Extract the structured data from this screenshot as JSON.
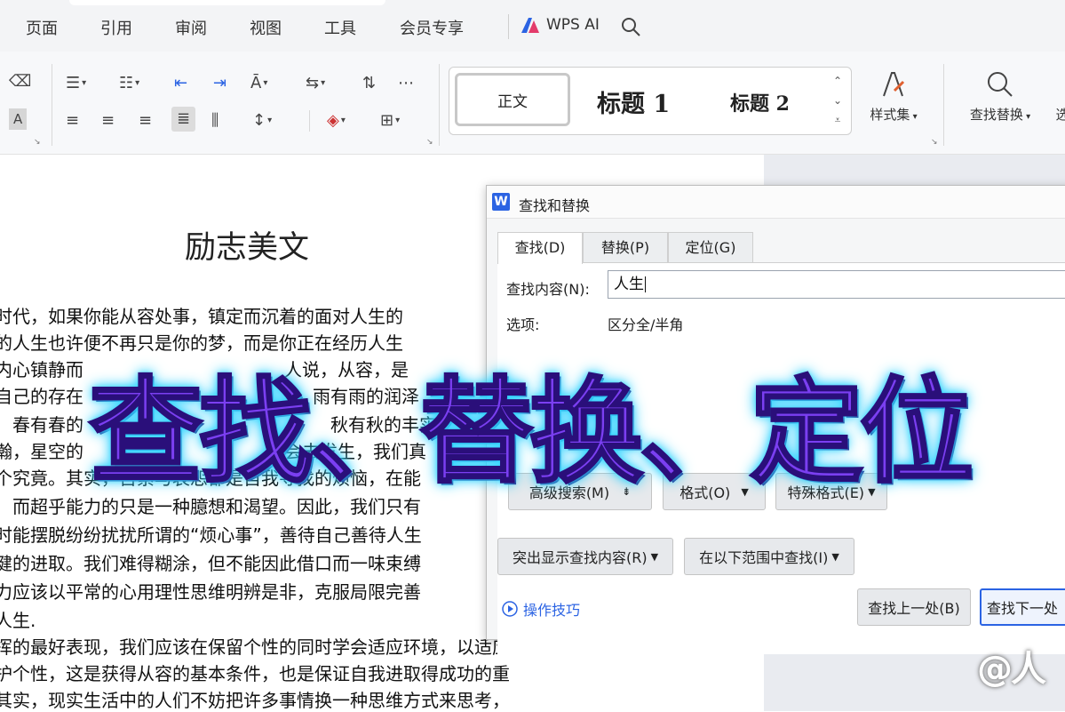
{
  "menu": {
    "items": [
      "页面",
      "引用",
      "审阅",
      "视图",
      "工具",
      "会员专享"
    ],
    "ai_label": "WPS AI"
  },
  "ribbon": {
    "styles": {
      "normal": "正文",
      "heading1": "标题 1",
      "heading2": "标题 2"
    },
    "style_set_label": "样式集",
    "find_replace_label": "查找替换",
    "truncated_label": "选"
  },
  "document": {
    "title": "励志美文",
    "lines": [
      "时代，如果你能从容处事，镇定而沉着的面对人生的",
      "的人生也许便不再只是你的梦，而是你正在经历人生",
      "内心镇静而",
      "自己的存在",
      "春有春的",
      "瀚，星空的",
      "个究竟。其实，苦累与哀怨都是自我寻找的烦恼，在能",
      "而超乎能力的只是一种臆想和渴望。因此，我们只有",
      "时能摆脱纷纷扰扰所谓的“烦心事”，善待自己善待人生",
      "健的进取。我们难得糊涂，但不能因此借口而一味束缚",
      "力应该以平常的心用理性思维明辨是非，克服局限完善",
      "人生.",
      "挥的最好表现，我们应该在保留个性的同时学会适应环境，以适应",
      "护个性，这是获得从容的基本条件，也是保证自我进取得成功的重",
      "其实，现实生活中的人们不妨把许多事情换一种思维方式来思考，"
    ],
    "fragments": {
      "f1": "人说，从容，是",
      "f2": "雨有雨的润泽",
      "f3": "秋有秋的丰实",
      "f4": "会去发生，我们真"
    }
  },
  "dialog": {
    "title": "查找和替换",
    "tabs": [
      "查找(D)",
      "替换(P)",
      "定位(G)"
    ],
    "find_label": "查找内容(N):",
    "find_value": "人生",
    "options_label": "选项:",
    "options_value": "区分全/半角",
    "buttons": {
      "advanced": "高级搜索(M)",
      "format": "格式(O)",
      "special": "特殊格式(E)",
      "highlight": "突出显示查找内容(R)",
      "find_in": "在以下范围中查找(I)",
      "find_prev": "查找上一处(B)",
      "find_next": "查找下一处"
    },
    "tips": "操作技巧"
  },
  "overlay": {
    "banner": "查找、替换、定位"
  },
  "watermark": "@人",
  "colors": {
    "accent": "#2b63e3",
    "banner_fill": "#7b3ff2",
    "banner_glow": "#38d9ff"
  }
}
